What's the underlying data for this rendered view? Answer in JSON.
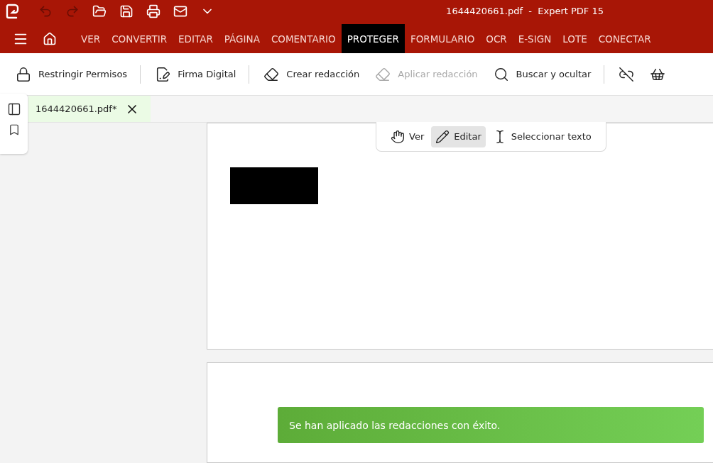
{
  "window": {
    "title": "1644420661.pdf  -  Expert PDF 15"
  },
  "quick_access": [
    {
      "kind": "undo",
      "disabled": true
    },
    {
      "kind": "redo",
      "disabled": true
    },
    {
      "kind": "open",
      "disabled": false
    },
    {
      "kind": "save",
      "disabled": false
    },
    {
      "kind": "print",
      "disabled": false
    },
    {
      "kind": "mail",
      "disabled": false
    },
    {
      "kind": "more",
      "disabled": false
    }
  ],
  "ribbon_tabs": [
    {
      "label": "VER",
      "selected": false
    },
    {
      "label": "CONVERTIR",
      "selected": false
    },
    {
      "label": "EDITAR",
      "selected": false
    },
    {
      "label": "PÁGINA",
      "selected": false
    },
    {
      "label": "COMENTARIO",
      "selected": false
    },
    {
      "label": "PROTEGER",
      "selected": true
    },
    {
      "label": "FORMULARIO",
      "selected": false
    },
    {
      "label": "OCR",
      "selected": false
    },
    {
      "label": "E-SIGN",
      "selected": false
    },
    {
      "label": "LOTE",
      "selected": false
    },
    {
      "label": "CONECTAR",
      "selected": false
    }
  ],
  "toolbar": [
    {
      "kind": "lock",
      "label": "Restringir Permisos",
      "disabled": false
    },
    {
      "kind": "divider"
    },
    {
      "kind": "sign",
      "label": "Firma Digital",
      "disabled": false
    },
    {
      "kind": "divider"
    },
    {
      "kind": "redact",
      "label": "Crear redacción",
      "disabled": false
    },
    {
      "kind": "apply",
      "label": "Aplicar redacción",
      "disabled": true
    },
    {
      "kind": "search",
      "label": "Buscar y ocultar",
      "disabled": false
    },
    {
      "kind": "divider"
    },
    {
      "kind": "unlink",
      "disabled": false
    },
    {
      "kind": "clean",
      "disabled": false
    }
  ],
  "document_tab": {
    "label": "1644420661.pdf*"
  },
  "mode_toolbar": [
    {
      "kind": "hand",
      "label": "Ver",
      "selected": false
    },
    {
      "kind": "edit",
      "label": "Editar",
      "selected": true
    },
    {
      "kind": "select",
      "label": "Seleccionar texto",
      "selected": false
    }
  ],
  "toast": {
    "message": "Se han aplicado las redacciones con éxito."
  }
}
